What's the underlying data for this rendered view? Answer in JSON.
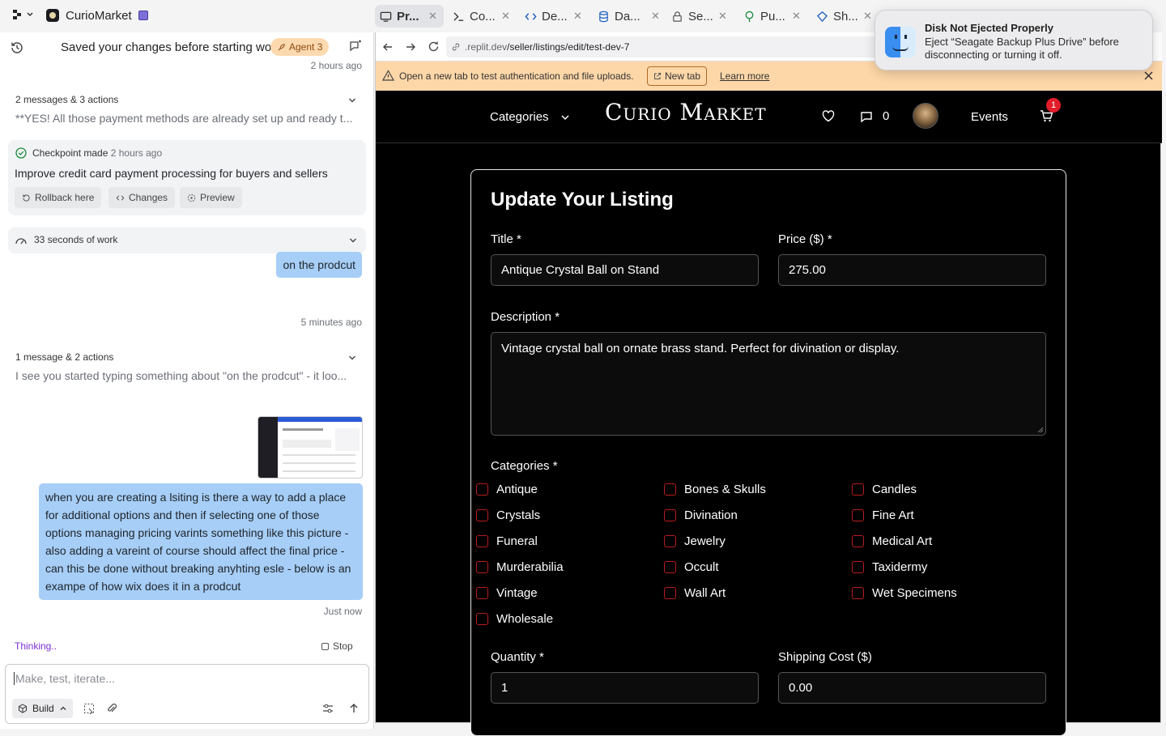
{
  "app": {
    "title": "CurioMarket"
  },
  "tabs": [
    {
      "label": "Pr...",
      "icon": "monitor-icon"
    },
    {
      "label": "Co...",
      "icon": "terminal-icon"
    },
    {
      "label": "De...",
      "icon": "code-icon"
    },
    {
      "label": "Da...",
      "icon": "database-icon"
    },
    {
      "label": "Se...",
      "icon": "lock-icon"
    },
    {
      "label": "Pu...",
      "icon": "tree-icon"
    },
    {
      "label": "Sh...",
      "icon": "shell-icon"
    }
  ],
  "agent": {
    "saved_text": "Saved your changes before starting work",
    "agent_badge": "Agent 3",
    "saved_time": "2 hours ago",
    "group1": {
      "title": "2 messages & 3 actions",
      "preview": "**YES! All those payment methods are already set up and ready t..."
    },
    "checkpoint": {
      "label": "Checkpoint made",
      "time": "2 hours ago",
      "title": "Improve credit card payment processing for buyers and sellers",
      "rollback": "Rollback here",
      "changes": "Changes",
      "preview": "Preview"
    },
    "work": {
      "label": "33 seconds of work"
    },
    "user_msg1": {
      "text": "on the prodcut",
      "time": "5 minutes ago"
    },
    "group2": {
      "title": "1 message & 2 actions",
      "preview": "I see you started typing something about \"on the prodcut\" - it loo..."
    },
    "user_msg2": {
      "text": "when you are creating a lsiting is there a way to add a place for additional options and then if selecting one of those options managing pricing varints something like this picture - also adding a vareint of course should affect the final price - can this be done without breaking anyhting esle - below is an exampe of how wix does it in a prodcut",
      "time": "Just now"
    },
    "thinking": "Thinking..",
    "stop": "Stop",
    "input_placeholder": "Make, test, iterate...",
    "build": "Build"
  },
  "browser": {
    "url_prefix": ".replit.dev",
    "url_path": "/seller/listings/edit/test-dev-7",
    "banner_text": "Open a new tab to test authentication and file uploads.",
    "new_tab": "New tab",
    "learn_more": "Learn more"
  },
  "site": {
    "categories_menu": "Categories",
    "logo": "Curio Market",
    "messages_count": "0",
    "events": "Events",
    "cart_badge": "1"
  },
  "form": {
    "heading": "Update Your Listing",
    "title_label": "Title *",
    "title_value": "Antique Crystal Ball on Stand",
    "price_label": "Price ($) *",
    "price_value": "275.00",
    "description_label": "Description *",
    "description_value": "Vintage crystal ball on ornate brass stand. Perfect for divination or display.",
    "categories_label": "Categories *",
    "categories": [
      "Antique",
      "Bones & Skulls",
      "Candles",
      "Crystals",
      "Divination",
      "Fine Art",
      "Funeral",
      "Jewelry",
      "Medical Art",
      "Murderabilia",
      "Occult",
      "Taxidermy",
      "Vintage",
      "Wall Art",
      "Wet Specimens",
      "Wholesale"
    ],
    "quantity_label": "Quantity *",
    "quantity_value": "1",
    "shipping_label": "Shipping Cost ($)",
    "shipping_value": "0.00"
  },
  "toast": {
    "title": "Disk Not Ejected Properly",
    "body": "Eject “Seagate Backup Plus Drive” before disconnecting or turning it off."
  },
  "colors": {
    "accent_orange": "#fed7a8",
    "user_bubble": "#a6cef7",
    "checkbox_border": "#b91c1c",
    "cart_badge": "#e11d2a",
    "thinking": "#7b2fd0"
  }
}
